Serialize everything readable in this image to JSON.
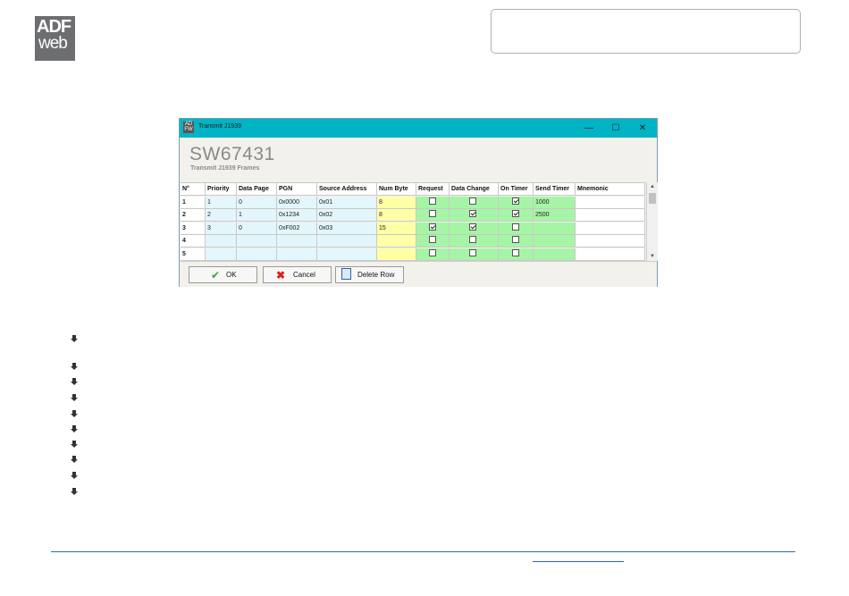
{
  "logo": {
    "line1": "ADF",
    "line2": "web"
  },
  "window": {
    "title": "Transmit J1939",
    "header_title": "SW67431",
    "header_subtitle": "Transmit J1939 Frames",
    "minimize": "—",
    "maximize": "☐",
    "close": "✕",
    "columns": [
      "N°",
      "Priority",
      "Data Page",
      "PGN",
      "Source Address",
      "Num Byte",
      "Request",
      "Data Change",
      "On Timer",
      "Send Timer",
      "Mnemonic"
    ],
    "rows": [
      {
        "n": "1",
        "priority": "1",
        "data_page": "0",
        "pgn": "0x0000",
        "source_address": "0x01",
        "num_byte": "8",
        "request": false,
        "data_change": false,
        "on_timer": true,
        "send_timer": "1000",
        "mnemonic": ""
      },
      {
        "n": "2",
        "priority": "2",
        "data_page": "1",
        "pgn": "0x1234",
        "source_address": "0x02",
        "num_byte": "8",
        "request": false,
        "data_change": true,
        "on_timer": true,
        "send_timer": "2500",
        "mnemonic": ""
      },
      {
        "n": "3",
        "priority": "3",
        "data_page": "0",
        "pgn": "0xF002",
        "source_address": "0x03",
        "num_byte": "15",
        "request": true,
        "data_change": true,
        "on_timer": false,
        "send_timer": "",
        "mnemonic": ""
      },
      {
        "n": "4",
        "priority": "",
        "data_page": "",
        "pgn": "",
        "source_address": "",
        "num_byte": "",
        "request": false,
        "data_change": false,
        "on_timer": false,
        "send_timer": "",
        "mnemonic": ""
      },
      {
        "n": "5",
        "priority": "",
        "data_page": "",
        "pgn": "",
        "source_address": "",
        "num_byte": "",
        "request": false,
        "data_change": false,
        "on_timer": false,
        "send_timer": "",
        "mnemonic": ""
      }
    ],
    "buttons": {
      "ok": "OK",
      "cancel": "Cancel",
      "delete_row": "Delete Row"
    }
  },
  "colors": {
    "titlebar": "#00b4c5",
    "blue_cells": "#e3f6fb",
    "yellow_cells": "#ffffa6",
    "green_cells": "#a6f5a6",
    "footer_line": "#2a6fa8"
  }
}
